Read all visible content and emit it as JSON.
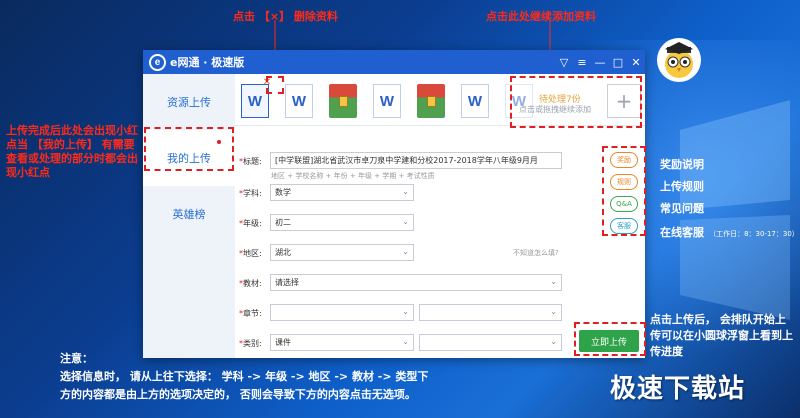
{
  "annotations": {
    "top_delete": "点击 【×】 删除资料",
    "top_add": "点击此处继续添加资料",
    "left_red_point": [
      "上传完成后此处会出现小红",
      "点当 【我的上传】 有需要",
      "查看或处理的部分时都会出",
      "现小红点"
    ],
    "right_labels": [
      "奖励说明",
      "上传规则",
      "常见问题",
      "在线客服"
    ],
    "service_hours": "（工作日：8：30-17：30）",
    "upload_note": [
      "点击上传后，  会排队开始上",
      "传可以在小圆球浮窗上看到上",
      "传进度"
    ],
    "bottom_note_title": "注意：",
    "bottom_note_lines": [
      "选择信息时，  请从上往下选择：  学科 -> 年级 -> 地区 -> 教材 -> 类型下",
      "方的内容都是由上方的选项决定的，  否则会导致下方的内容点击无选项。"
    ]
  },
  "window": {
    "title": "e网通 · 极速版",
    "logo_letter": "e"
  },
  "sidebar": {
    "items": [
      {
        "label": "资源上传"
      },
      {
        "label": "我的上传"
      },
      {
        "label": "英雄榜"
      }
    ]
  },
  "files": {
    "pending": "待处理7份",
    "pending_sub": "点击或拖拽继续添加",
    "doc_letter": "W",
    "delete_glyph": "✕",
    "add_glyph": "+"
  },
  "form": {
    "title_label": "标题:",
    "title_value": "[中学联盟]湖北省武汉市卓刀泉中学建和分校2017-2018学年八年级9月月",
    "title_hint": "地区 + 学校名称 + 年份 + 年级 + 学期 + 考试性质",
    "subject_label": "学科:",
    "subject_value": "数学",
    "grade_label": "年级:",
    "grade_value": "初二",
    "region_label": "地区:",
    "region_value": "湖北",
    "region_help": "不知道怎么填?",
    "textbook_label": "教材:",
    "textbook_value": "请选择",
    "chapter_label": "章节:",
    "type_label": "类别:",
    "type_value": "课件",
    "submit": "立即上传"
  },
  "tools": [
    {
      "label": "奖励",
      "color": "#e8862a"
    },
    {
      "label": "规则",
      "color": "#e8862a"
    },
    {
      "label": "Q&A",
      "color": "#3aa64a"
    },
    {
      "label": "客服",
      "color": "#2aa0c8"
    }
  ],
  "watermark": "极速下载站"
}
